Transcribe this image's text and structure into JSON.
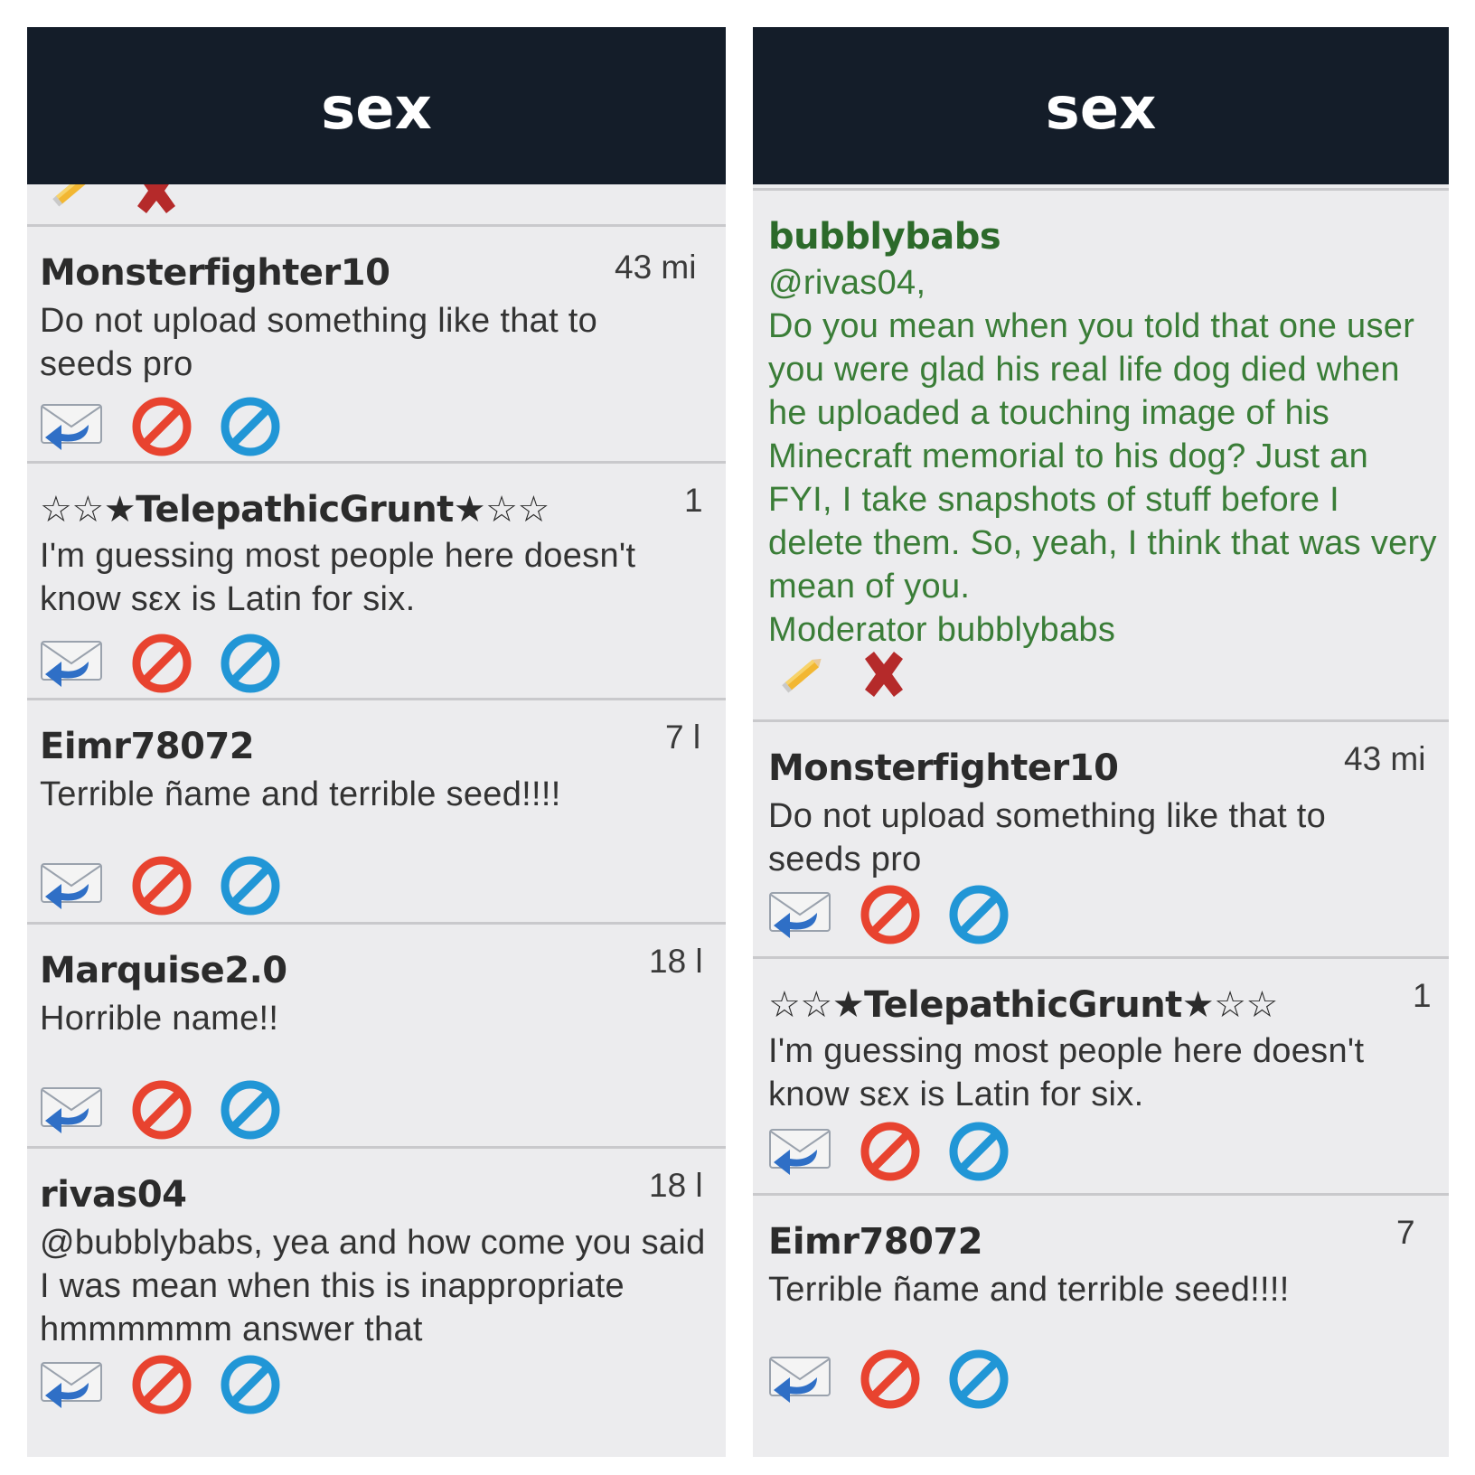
{
  "left": {
    "header_title": "sex",
    "comments": [
      {
        "user": "Monsterfighter10",
        "time": "43 mi",
        "text": "Do not upload something like that to seeds pro"
      },
      {
        "user": "☆☆★TelepathicGrunt★☆☆",
        "time": "1",
        "text": "I'm guessing most people here doesn't know sεx is Latin for six."
      },
      {
        "user": "Eimr78072",
        "time": "7 l",
        "text": "Terrible ñame and terrible seed!!!!"
      },
      {
        "user": "Marquise2.0",
        "time": "18 l",
        "text": "Horrible name!!"
      },
      {
        "user": "rivas04",
        "time": "18 l",
        "text": "@bubblybabs, yea and how come you said I was mean when this is inappropriate hmmmmmm answer that"
      }
    ]
  },
  "right": {
    "header_title": "sex",
    "moderator_post": {
      "user": "bubblybabs",
      "lines": [
        "@rivas04,",
        "Do you mean when you told that one user you were glad his real life dog died when he uploaded a touching image of his Minecraft memorial to his dog?  Just an FYI, I take snapshots of stuff before I delete them.  So, yeah, I think that was very mean of you.",
        "Moderator bubblybabs"
      ]
    },
    "comments": [
      {
        "user": "Monsterfighter10",
        "time": "43 mi",
        "text": "Do not upload something like that to seeds pro"
      },
      {
        "user": "☆☆★TelepathicGrunt★☆☆",
        "time": "1",
        "text": "I'm guessing most people here doesn't know sεx is Latin for six."
      },
      {
        "user": "Eimr78072",
        "time": "7",
        "text": "Terrible ñame and terrible seed!!!!"
      }
    ]
  },
  "icons": {
    "reply": "reply-envelope-icon",
    "flag": "red-no-icon",
    "block": "blue-block-icon",
    "edit": "pencil-icon",
    "delete": "red-x-icon"
  },
  "colors": {
    "header_bg": "#141d29",
    "panel_bg": "#ececee",
    "moderator_green": "#3a7d37"
  }
}
